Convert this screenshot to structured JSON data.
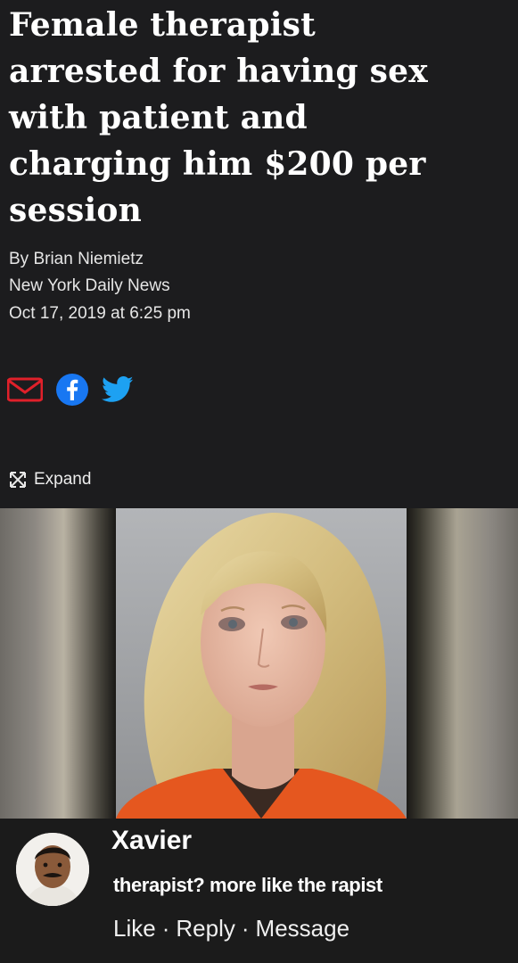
{
  "article": {
    "headline_lines": [
      "Female therapist",
      "arrested for having sex",
      "with patient and",
      "charging him $200 per",
      "session"
    ],
    "byline": "By Brian Niemietz",
    "outlet": "New York Daily News",
    "datetime": "Oct 17, 2019 at 6:25 pm",
    "share_icons": [
      "email-icon",
      "facebook-icon",
      "twitter-icon"
    ],
    "expand_label": "Expand"
  },
  "comment": {
    "author": "Xavier",
    "text": "therapist? more like the rapist",
    "actions": [
      "Like",
      "Reply",
      "Message"
    ],
    "separator": "·"
  },
  "colors": {
    "background": "#1c1c1e",
    "email": "#e0202a",
    "facebook": "#1877f2",
    "twitter": "#1da1f2",
    "jumpsuit": "#e5571f"
  }
}
